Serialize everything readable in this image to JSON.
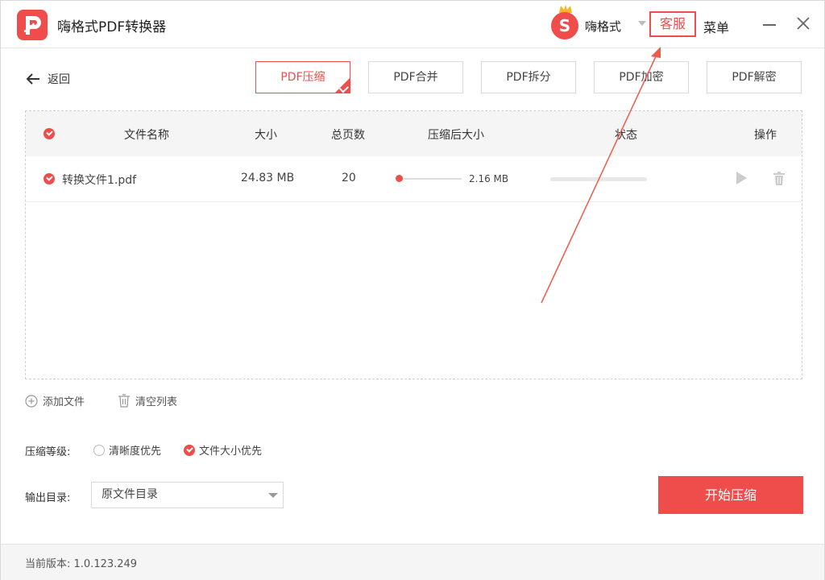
{
  "app": {
    "title": "嗨格式PDF转换器"
  },
  "header": {
    "user_name": "嗨格式",
    "service_label": "客服",
    "menu_label": "菜单"
  },
  "nav": {
    "back_label": "返回"
  },
  "tabs": [
    {
      "label": "PDF压缩",
      "active": true
    },
    {
      "label": "PDF合并"
    },
    {
      "label": "PDF拆分"
    },
    {
      "label": "PDF加密"
    },
    {
      "label": "PDF解密"
    }
  ],
  "table": {
    "headers": {
      "name": "文件名称",
      "size": "大小",
      "pages": "总页数",
      "compressed": "压缩后大小",
      "status": "状态",
      "actions": "操作"
    },
    "rows": [
      {
        "name": "转换文件1.pdf",
        "size": "24.83 MB",
        "pages": "20",
        "compressed_size": "2.16 MB"
      }
    ]
  },
  "actions": {
    "add_file": "添加文件",
    "clear_list": "清空列表"
  },
  "compression": {
    "label": "压缩等级:",
    "option_clarity": "清晰度优先",
    "option_size": "文件大小优先"
  },
  "output": {
    "label": "输出目录:",
    "selected": "原文件目录"
  },
  "start_button": "开始压缩",
  "footer": {
    "version_text": "当前版本: 1.0.123.249"
  },
  "colors": {
    "accent": "#ef4c4c"
  }
}
